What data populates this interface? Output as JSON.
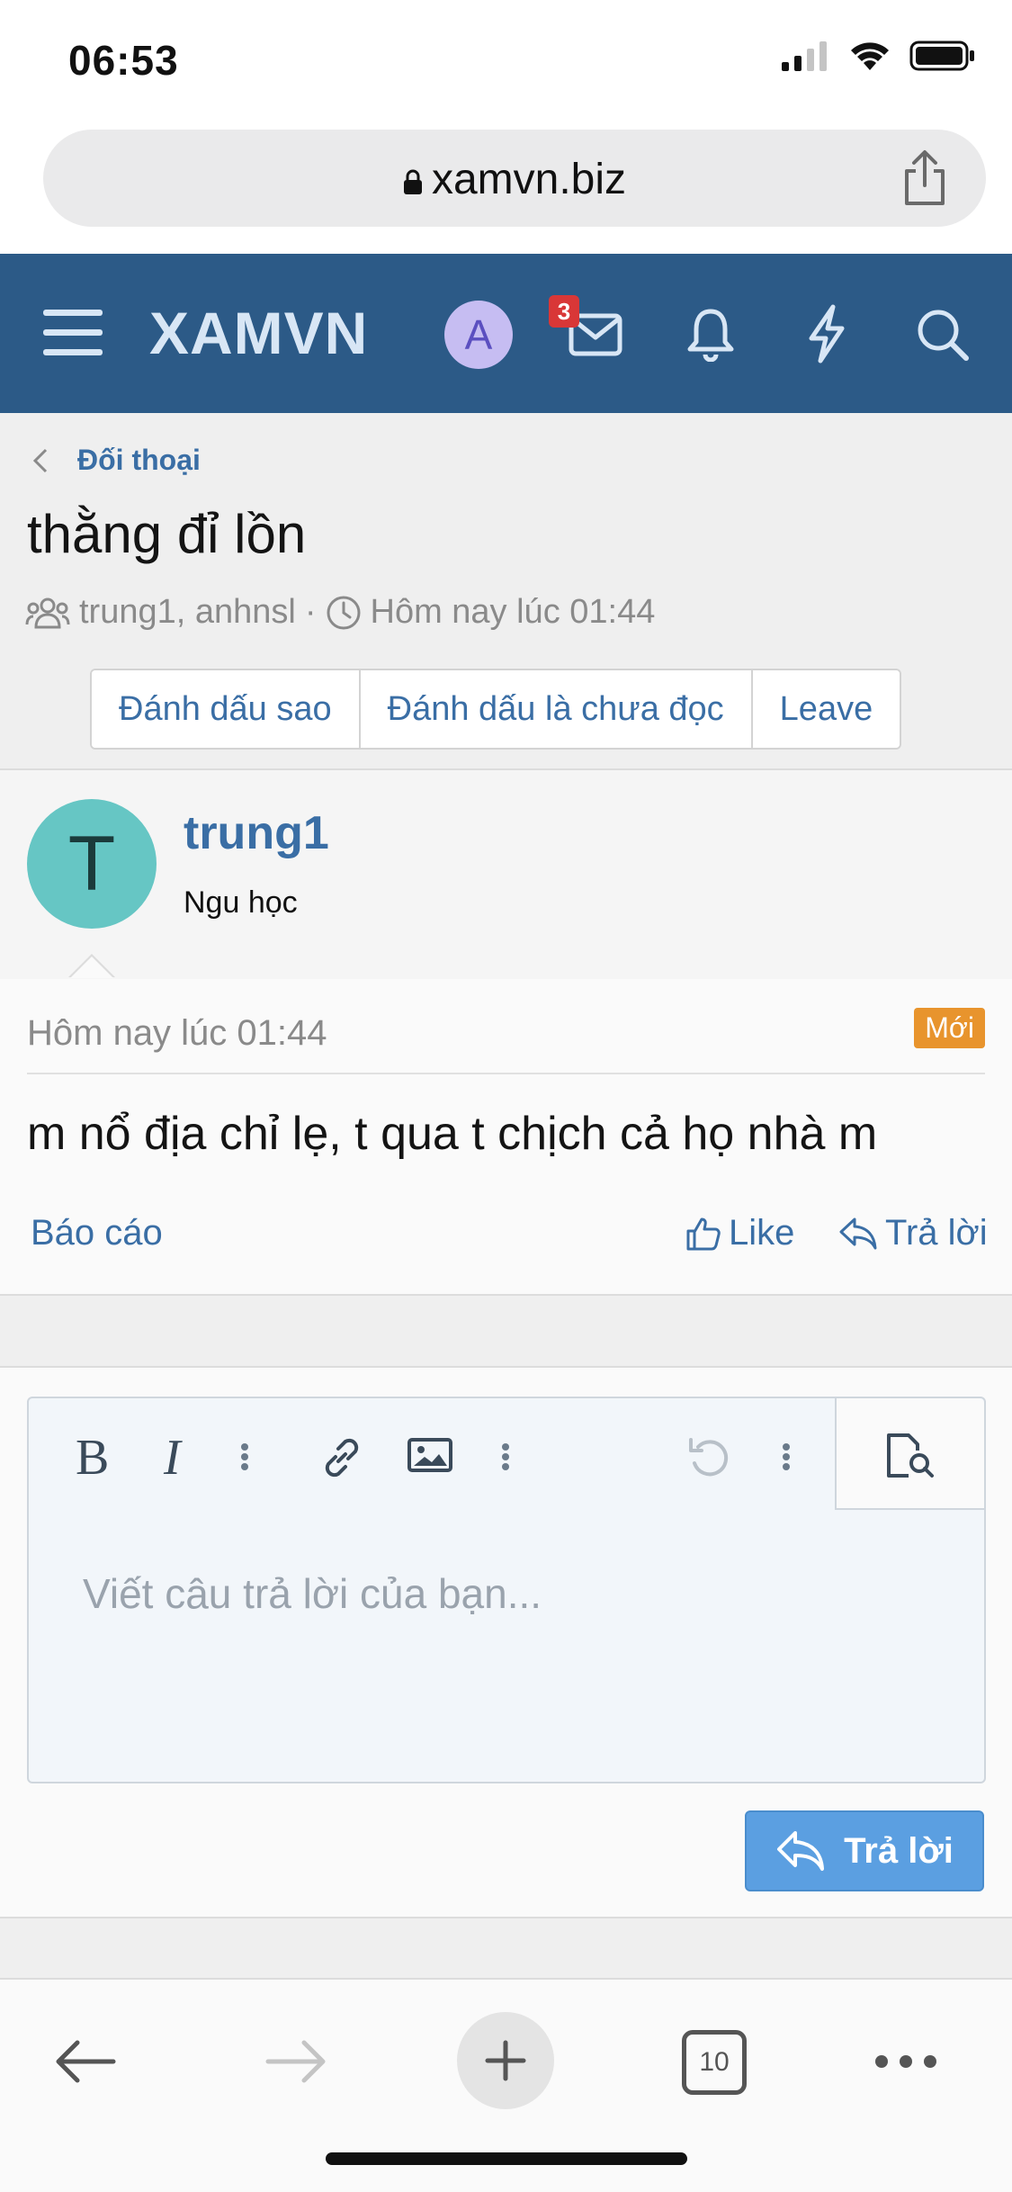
{
  "status_bar": {
    "time": "06:53"
  },
  "browser": {
    "url": "xamvn.biz",
    "tab_count": "10"
  },
  "nav": {
    "logo": "XAMVN",
    "avatar_letter": "A",
    "inbox_badge": "3"
  },
  "breadcrumb": {
    "label": "Đối thoại"
  },
  "conversation": {
    "title": "thằng đỉ lồn",
    "participants": "trung1, anhnsl",
    "separator": "·",
    "time": "Hôm nay lúc 01:44"
  },
  "buttons": {
    "star": "Đánh dấu sao",
    "mark_unread": "Đánh dấu là chưa đọc",
    "leave": "Leave"
  },
  "message": {
    "avatar_letter": "T",
    "username": "trung1",
    "user_title": "Ngu học",
    "date": "Hôm nay lúc 01:44",
    "new_badge": "Mới",
    "text": "m nổ địa chỉ lẹ, t qua t chịch cả họ nhà m",
    "report": "Báo cáo",
    "like": "Like",
    "reply": "Trả lời"
  },
  "editor": {
    "placeholder": "Viết câu trả lời của bạn...",
    "submit": "Trả lời"
  },
  "colors": {
    "nav_bg": "#2c5a87",
    "link": "#3a6ea5",
    "new_badge": "#e8942d",
    "submit_bg": "#5b9fe1",
    "avatar_user": "#66c6c4",
    "avatar_self": "#c6bdf2"
  }
}
